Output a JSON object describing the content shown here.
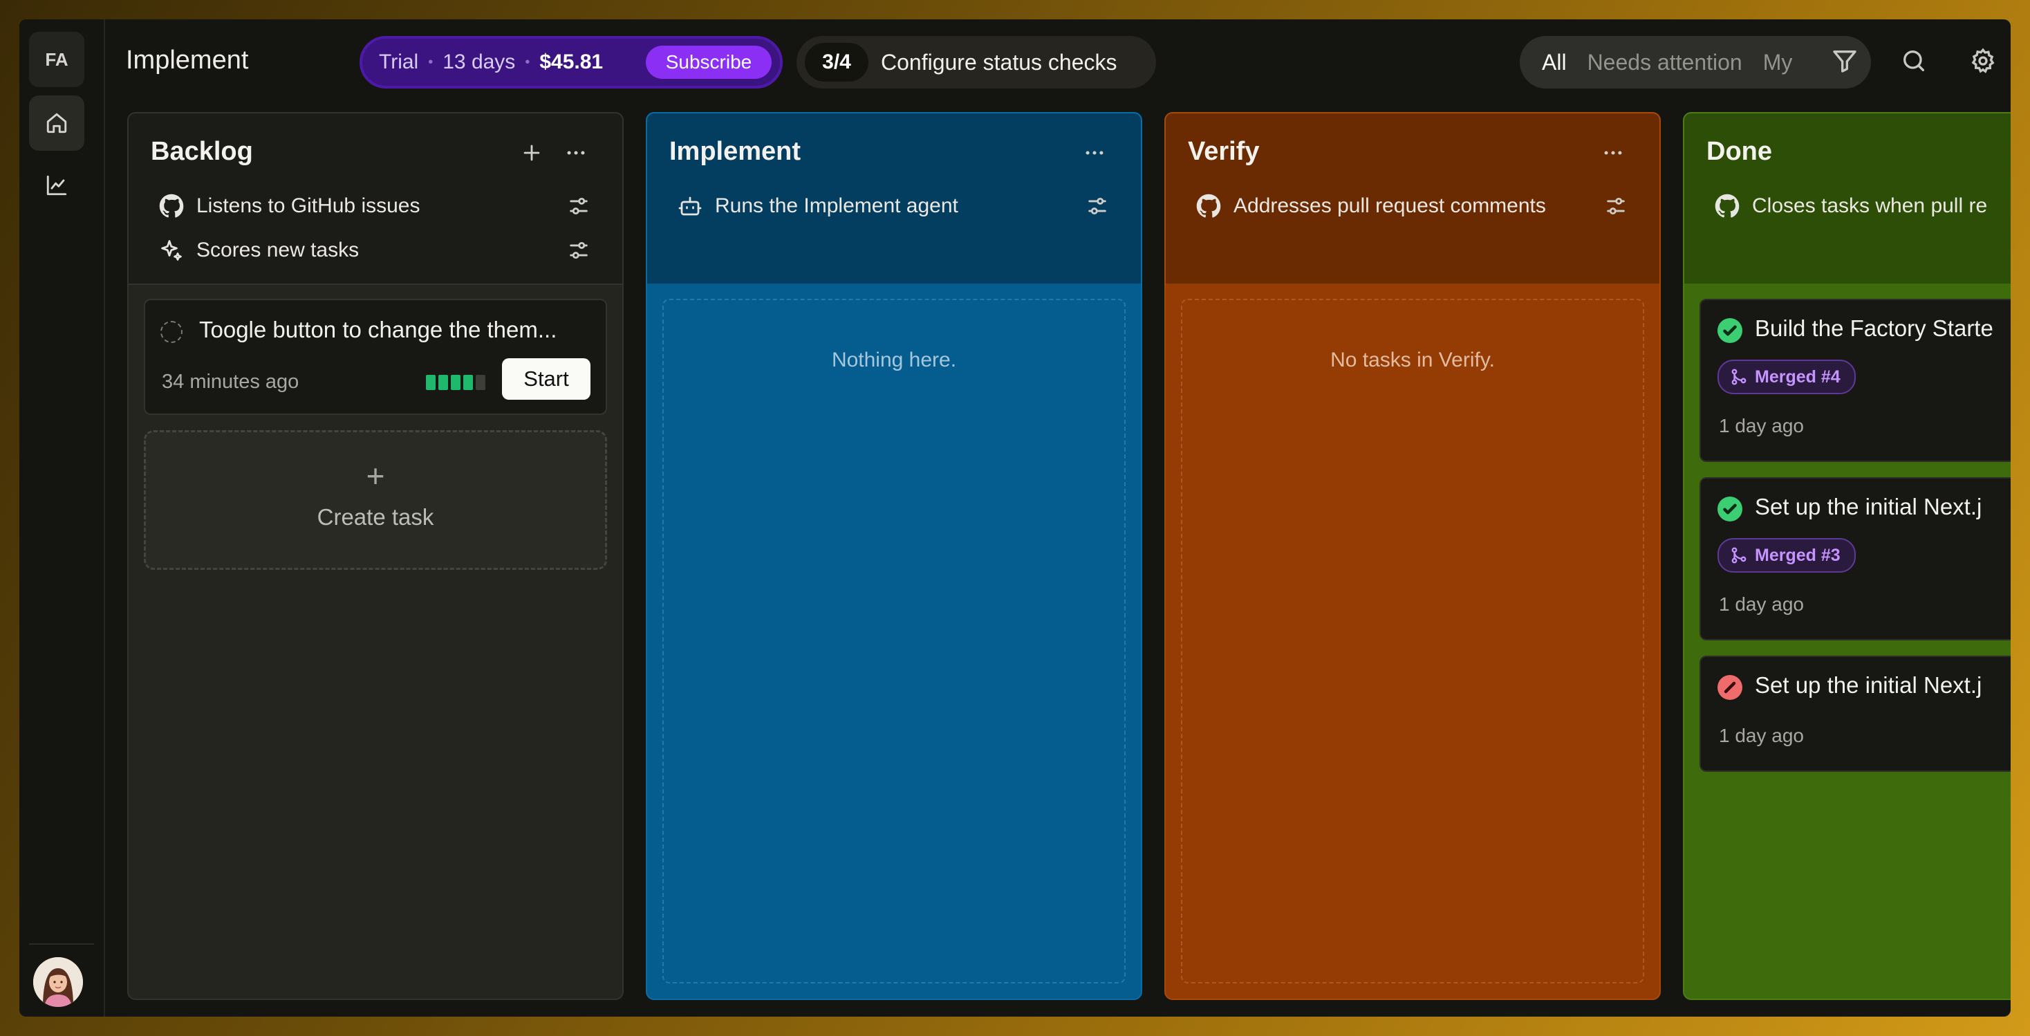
{
  "workspace": {
    "initials": "FA"
  },
  "sidebar": {
    "items": [
      {
        "icon": "home-icon"
      },
      {
        "icon": "chart-icon"
      }
    ]
  },
  "header": {
    "title": "Implement",
    "trial": {
      "label": "Trial",
      "days": "13 days",
      "price": "$45.81",
      "subscribe_label": "Subscribe"
    },
    "checks": {
      "count": "3/4",
      "label": "Configure status checks"
    },
    "filters": {
      "tabs": [
        "All",
        "Needs attention",
        "My"
      ],
      "active": "All"
    }
  },
  "columns": [
    {
      "title": "Backlog",
      "color": "#252520",
      "rules": [
        {
          "icon": "github-icon",
          "label": "Listens to GitHub issues"
        },
        {
          "icon": "sparkles-icon",
          "label": "Scores new tasks"
        }
      ],
      "tasks": [
        {
          "title": "Toogle button to change the them...",
          "time": "34 minutes ago",
          "priority": 4,
          "priority_max": 5,
          "action": "Start"
        }
      ],
      "create_label": "Create task"
    },
    {
      "title": "Implement",
      "color": "#045d8e",
      "rules": [
        {
          "icon": "bot-icon",
          "label": "Runs the Implement agent"
        }
      ],
      "empty_text": "Nothing here."
    },
    {
      "title": "Verify",
      "color": "#953c04",
      "rules": [
        {
          "icon": "github-icon",
          "label": "Addresses pull request comments"
        }
      ],
      "empty_text": "No tasks in Verify."
    },
    {
      "title": "Done",
      "color": "#3e6b0c",
      "rules": [
        {
          "icon": "github-icon",
          "label": "Closes tasks when pull re"
        }
      ],
      "tasks": [
        {
          "status": "success",
          "title": "Build the Factory Starte",
          "badge": "Merged #4",
          "time": "1 day ago"
        },
        {
          "status": "success",
          "title": "Set up the initial Next.j",
          "badge": "Merged #3",
          "time": "1 day ago"
        },
        {
          "status": "failed",
          "title": "Set up the initial Next.j",
          "time": "1 day ago"
        }
      ]
    }
  ]
}
